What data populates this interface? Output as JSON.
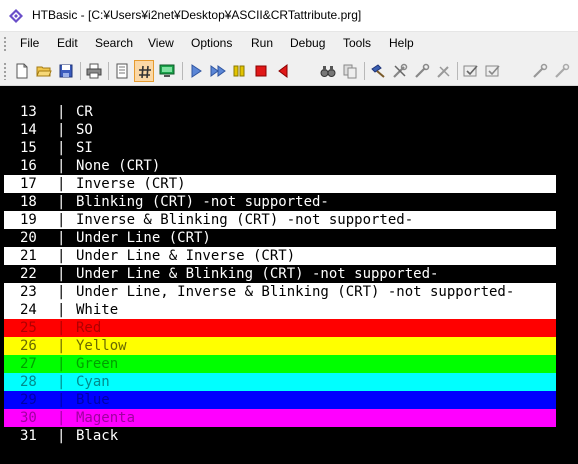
{
  "window": {
    "title": "HTBasic - [C:¥Users¥i2net¥Desktop¥ASCII&CRTattribute.prg]"
  },
  "menu": [
    "File",
    "Edit",
    "Search",
    "View",
    "Options",
    "Run",
    "Debug",
    "Tools",
    "Help"
  ],
  "toolbar": {
    "buttons": [
      "new-file-icon",
      "open-folder-icon",
      "save-icon",
      "print-icon",
      "notes-icon",
      "hash-icon",
      "screen-icon",
      "play-icon",
      "step-icon",
      "pause-icon",
      "stop-icon",
      "back-icon",
      "binoculars-icon",
      "replace-icon",
      "hammer-icon",
      "tools-icon",
      "wrench-icon",
      "tools2-icon",
      "check-icon",
      "check2-icon",
      "settings-icon",
      "settings2-icon"
    ],
    "active_button": "hash-icon"
  },
  "editor": {
    "separator": "|",
    "lines": [
      {
        "num": "13",
        "text": "CR",
        "bg": "#000000",
        "fg": "#ffffff"
      },
      {
        "num": "14",
        "text": "SO",
        "bg": "#000000",
        "fg": "#ffffff"
      },
      {
        "num": "15",
        "text": "SI",
        "bg": "#000000",
        "fg": "#ffffff"
      },
      {
        "num": "16",
        "text": "None (CRT)",
        "bg": "#000000",
        "fg": "#ffffff"
      },
      {
        "num": "17",
        "text": "Inverse (CRT)",
        "bg": "#ffffff",
        "fg": "#000000"
      },
      {
        "num": "18",
        "text": "Blinking (CRT) -not supported-",
        "bg": "#000000",
        "fg": "#ffffff"
      },
      {
        "num": "19",
        "text": "Inverse & Blinking (CRT) -not supported-",
        "bg": "#ffffff",
        "fg": "#000000"
      },
      {
        "num": "20",
        "text": "Under Line (CRT)",
        "bg": "#000000",
        "fg": "#ffffff"
      },
      {
        "num": "21",
        "text": "Under Line & Inverse (CRT)",
        "bg": "#ffffff",
        "fg": "#000000"
      },
      {
        "num": "22",
        "text": "Under Line & Blinking (CRT) -not supported-",
        "bg": "#000000",
        "fg": "#ffffff"
      },
      {
        "num": "23",
        "text": "Under Line, Inverse & Blinking (CRT) -not supported-",
        "bg": "#ffffff",
        "fg": "#000000"
      },
      {
        "num": "24",
        "text": "White",
        "bg": "#ffffff",
        "fg": "#000000"
      },
      {
        "num": "25",
        "text": "Red",
        "bg": "#ff0000",
        "fg": "#b00000"
      },
      {
        "num": "26",
        "text": "Yellow",
        "bg": "#ffff00",
        "fg": "#6a6a00"
      },
      {
        "num": "27",
        "text": "Green",
        "bg": "#00ff00",
        "fg": "#00a000"
      },
      {
        "num": "28",
        "text": "Cyan",
        "bg": "#00ffff",
        "fg": "#008c8c"
      },
      {
        "num": "29",
        "text": "Blue",
        "bg": "#0000ff",
        "fg": "#0000a8"
      },
      {
        "num": "30",
        "text": "Magenta",
        "bg": "#ff00ff",
        "fg": "#a000a0"
      },
      {
        "num": "31",
        "text": "Black",
        "bg": "#000000",
        "fg": "#ffffff"
      }
    ]
  }
}
